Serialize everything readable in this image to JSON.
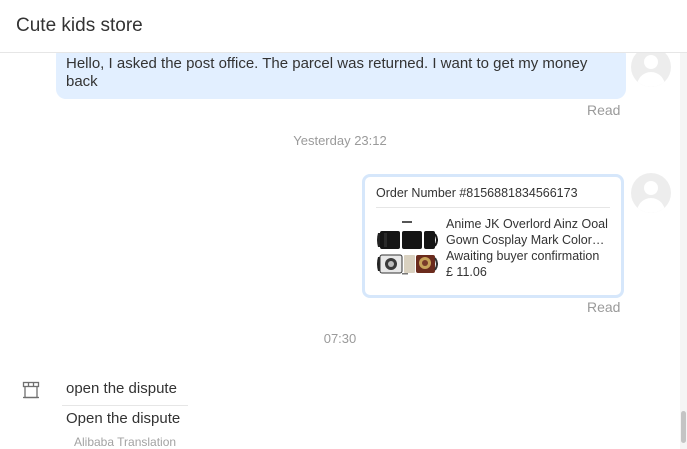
{
  "header": {
    "title": "Cute kids store"
  },
  "messages": {
    "outgoing_text": "Hello, I asked the post office. The parcel was returned. I want to get my money back",
    "read_label_1": "Read",
    "timestamp_1": "Yesterday 23:12",
    "order_card": {
      "order_number": "Order Number #8156881834566173",
      "product_name": "Anime JK Overlord Ainz Ooal Gown Cosplay Mark Color Changing Mug",
      "status": "Awaiting buyer confirmation",
      "price": "£ 11.06"
    },
    "read_label_2": "Read",
    "timestamp_2": "07:30",
    "incoming_text": "open the dispute",
    "translated_text": "Open the dispute",
    "translation_label": "Alibaba Translation"
  },
  "icons": {
    "avatar": "user-avatar-icon",
    "store": "store-icon",
    "product": "product-thumbnail"
  },
  "colors": {
    "outgoing_bubble": "#e2efff",
    "card_border": "#d6e7fb",
    "muted_text": "#9a9a9a"
  }
}
